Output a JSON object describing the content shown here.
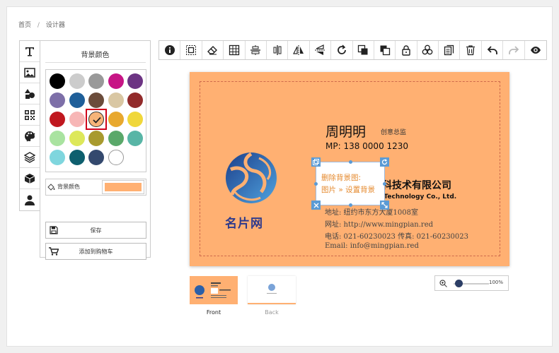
{
  "breadcrumb": {
    "home": "首页",
    "separator": "/",
    "current": "设计器"
  },
  "tools": [
    {
      "name": "text-tool",
      "icon": "text-icon"
    },
    {
      "name": "image-tool",
      "icon": "image-icon"
    },
    {
      "name": "shape-tool",
      "icon": "shapes-icon"
    },
    {
      "name": "qrcode-tool",
      "icon": "qrcode-icon"
    },
    {
      "name": "background-tool",
      "icon": "palette-icon"
    },
    {
      "name": "layers-tool",
      "icon": "layers-icon"
    },
    {
      "name": "template-tool",
      "icon": "cube-icon"
    },
    {
      "name": "user-tool",
      "icon": "user-icon"
    }
  ],
  "panel": {
    "title": "背景颜色",
    "colors": [
      "#000000",
      "#cccccc",
      "#999999",
      "#c71585",
      "#6c3483",
      "#7d6fa8",
      "#1f5f99",
      "#6b4c3b",
      "#d9c7a3",
      "#922b2b",
      "#c0181f",
      "#f7b6b6",
      "#f7b479",
      "#e8a82e",
      "#f0d73a",
      "#a9e3a0",
      "#dde85a",
      "#a89a2e",
      "#5aa86a",
      "#58b5a6",
      "#7fd6de",
      "#0e5f6e",
      "#34496e",
      "#ffffff"
    ],
    "selected_index": 12,
    "bg_label": "背景颜色",
    "bg_value": "#ffb072",
    "save_label": "保存",
    "cart_label": "添加到购物车"
  },
  "toolbar": [
    "info-icon",
    "select-all-icon",
    "eraser-icon",
    "grid-icon",
    "align-center-horizontal-icon",
    "align-center-vertical-icon",
    "flip-horizontal-icon",
    "flip-vertical-icon",
    "rotate-icon",
    "bring-forward-icon",
    "send-backward-icon",
    "lock-icon",
    "group-icon",
    "copy-icon",
    "trash-icon",
    "undo-icon",
    "redo-icon",
    "preview-icon"
  ],
  "card": {
    "background": "#ffb072",
    "name": "周明明",
    "role": "创意总监",
    "mp": "MP: 138 0000 1230",
    "company_cn": "科技术有限公司",
    "company_en": "t Technology Co., Ltd.",
    "address": "地址: 纽约市东方大厦1008室",
    "website": "网址: http://www.mingpian.red",
    "phone": "电话: 021-60230023  传真: 021-60230023",
    "email": "Email: info@mingpian.red",
    "brand": "名片网",
    "selected_text_line1": "删除背景图:",
    "selected_text_line2": "图片 » 设置背景"
  },
  "pages": {
    "front": "Front",
    "back": "Back"
  },
  "zoom": {
    "value": "100%",
    "level": 0.1
  }
}
